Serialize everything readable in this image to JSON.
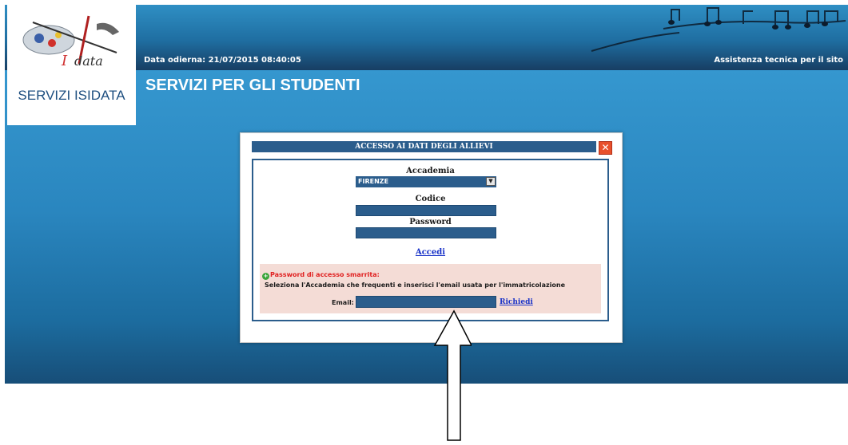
{
  "header": {
    "brand_caption": "SERVIZI ISIDATA",
    "date_text": "Data odierna: 21/07/2015 08:40:05",
    "assist_link": "Assistenza tecnica per il sito",
    "page_title": "SERVIZI PER GLI STUDENTI"
  },
  "login": {
    "title": "ACCESSO AI DATI DEGLI ALLIEVI",
    "close_glyph": "✕",
    "academy_label": "Accademia",
    "academy_value": "FIRENZE",
    "code_label": "Codice",
    "code_value": "",
    "password_label": "Password",
    "password_value": "",
    "submit_label": "Accedi"
  },
  "recovery": {
    "heading": "Password di accesso smarrita:",
    "instruction": "Seleziona l'Accademia che frequenti e inserisci l'email usata per l'immatricolazione",
    "email_label": "Email:",
    "email_value": "",
    "request_label": "Richiedi"
  },
  "colors": {
    "band": "#2a86bf",
    "field": "#2b5d8c",
    "panel": "#f4dcd6",
    "link": "#1a33c8",
    "error": "#e02020"
  },
  "icons": [
    "logo-palette-icon",
    "music-notes-decoration",
    "close-icon",
    "info-bullet-icon",
    "annotation-arrow"
  ]
}
